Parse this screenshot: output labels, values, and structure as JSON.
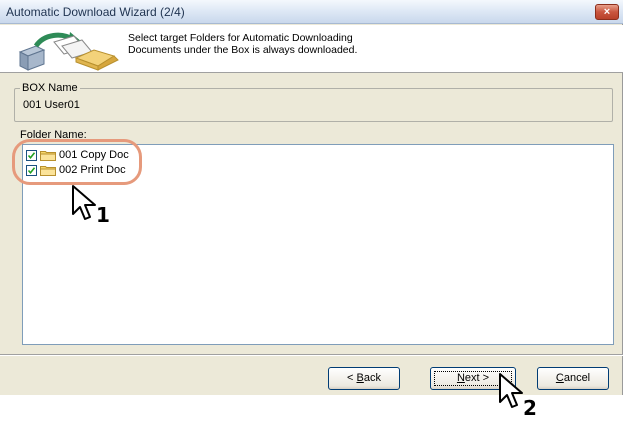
{
  "window": {
    "title": "Automatic Download Wizard (2/4)",
    "close_glyph": "×"
  },
  "header": {
    "line1": "Select target Folders for Automatic Downloading",
    "line2": "Documents under the Box is always downloaded."
  },
  "box": {
    "legend": "BOX Name",
    "value": "001 User01"
  },
  "folders": {
    "label": "Folder Name:",
    "items": [
      {
        "label": "001 Copy Doc",
        "checked": true
      },
      {
        "label": "002 Print Doc",
        "checked": true
      }
    ]
  },
  "buttons": {
    "back_prefix": "< ",
    "back_mnemonic": "B",
    "back_rest": "ack",
    "next_mnemonic": "N",
    "next_rest": "ext >",
    "cancel_mnemonic": "C",
    "cancel_rest": "ancel"
  },
  "annotations": {
    "step1": "1",
    "step2": "2",
    "highlight_color": "#e69a7c"
  }
}
